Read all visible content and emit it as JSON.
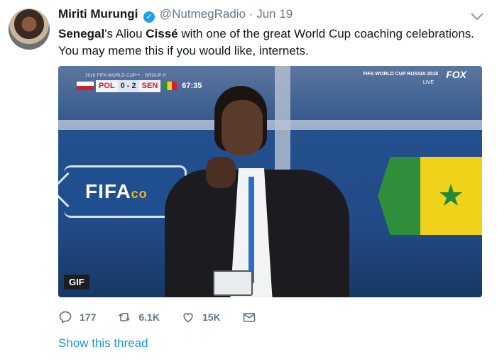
{
  "tweet": {
    "author_name": "Miriti Murungi",
    "handle": "@NutmegRadio",
    "separator": "·",
    "date": "Jun 19",
    "text_parts": {
      "p1": "Senegal",
      "p2": "'s Aliou ",
      "p3": "Cissé",
      "p4": " with one of the great World Cup coaching celebrations. You may meme this if you would like, internets."
    }
  },
  "media": {
    "scorebug": {
      "top_line": "2018 FIFA WORLD CUP™ · GROUP H",
      "team1": "POL",
      "score": "0 - 2",
      "team2": "SEN",
      "time": "67:35"
    },
    "broadcast": {
      "event": "FIFA WORLD CUP RUSSIA 2018",
      "network": "FOX",
      "live": "LIVE"
    },
    "board_text": "FIFA",
    "board_text_suffix": "co",
    "gif_label": "GIF"
  },
  "actions": {
    "replies": "177",
    "retweets": "6.1K",
    "likes": "15K"
  },
  "show_thread": "Show this thread",
  "colors": {
    "link": "#1b95e0",
    "verified": "#1da1f2",
    "muted": "#657786"
  },
  "icons": [
    "verified-badge-icon",
    "chevron-down-icon",
    "reply-icon",
    "retweet-icon",
    "like-icon",
    "direct-message-icon"
  ]
}
